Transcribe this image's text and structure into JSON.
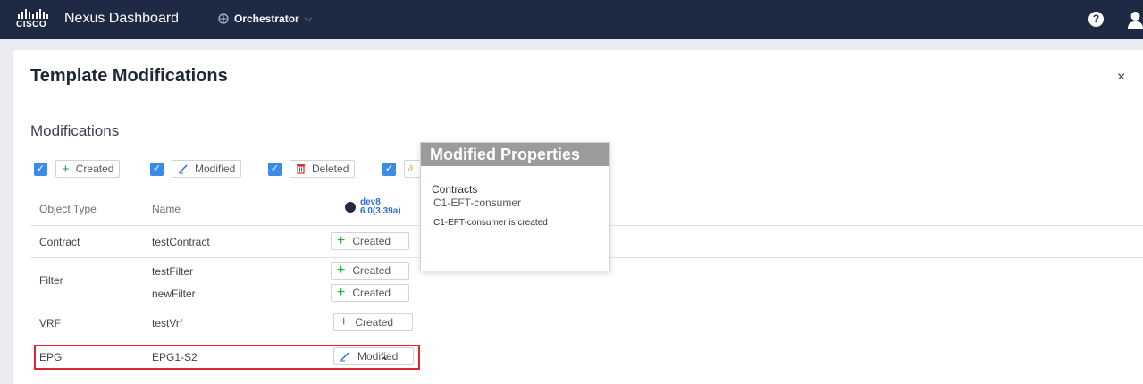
{
  "topbar": {
    "brand": "CISCO",
    "app_title": "Nexus Dashboard",
    "service": "Orchestrator",
    "help_label": "?"
  },
  "modal": {
    "title": "Template Modifications",
    "close_label": "×",
    "section_title": "Modifications"
  },
  "filters": [
    {
      "label": "Created",
      "checked": true,
      "icon": "plus-icon"
    },
    {
      "label": "Modified",
      "checked": true,
      "icon": "pencil-icon"
    },
    {
      "label": "Deleted",
      "checked": true,
      "icon": "trash-icon"
    },
    {
      "label": "",
      "checked": true,
      "icon": "link-icon"
    }
  ],
  "table": {
    "headers": {
      "object_type": "Object Type",
      "name": "Name"
    },
    "site": {
      "name": "dev8",
      "version": "6.0(3.39a)"
    },
    "rows": [
      {
        "type": "Contract",
        "names": [
          "testContract"
        ],
        "statuses": [
          "Created"
        ]
      },
      {
        "type": "Filter",
        "names": [
          "testFilter",
          "newFilter"
        ],
        "statuses": [
          "Created",
          "Created"
        ]
      },
      {
        "type": "VRF",
        "names": [
          "testVrf"
        ],
        "statuses": [
          "Created"
        ]
      },
      {
        "type": "EPG",
        "names": [
          "EPG1-S2"
        ],
        "statuses": [
          "Modified"
        ]
      }
    ]
  },
  "popover": {
    "title": "Modified Properties",
    "section": "Contracts",
    "item": "C1-EFT-consumer",
    "message": "C1-EFT-consumer is created"
  },
  "colors": {
    "topbar": "#1e2a44",
    "checkbox": "#3b8ae6",
    "created_icon": "#27a745",
    "modified_icon": "#2f6fd6",
    "deleted_icon": "#d9302b",
    "highlight": "#e0242c"
  }
}
